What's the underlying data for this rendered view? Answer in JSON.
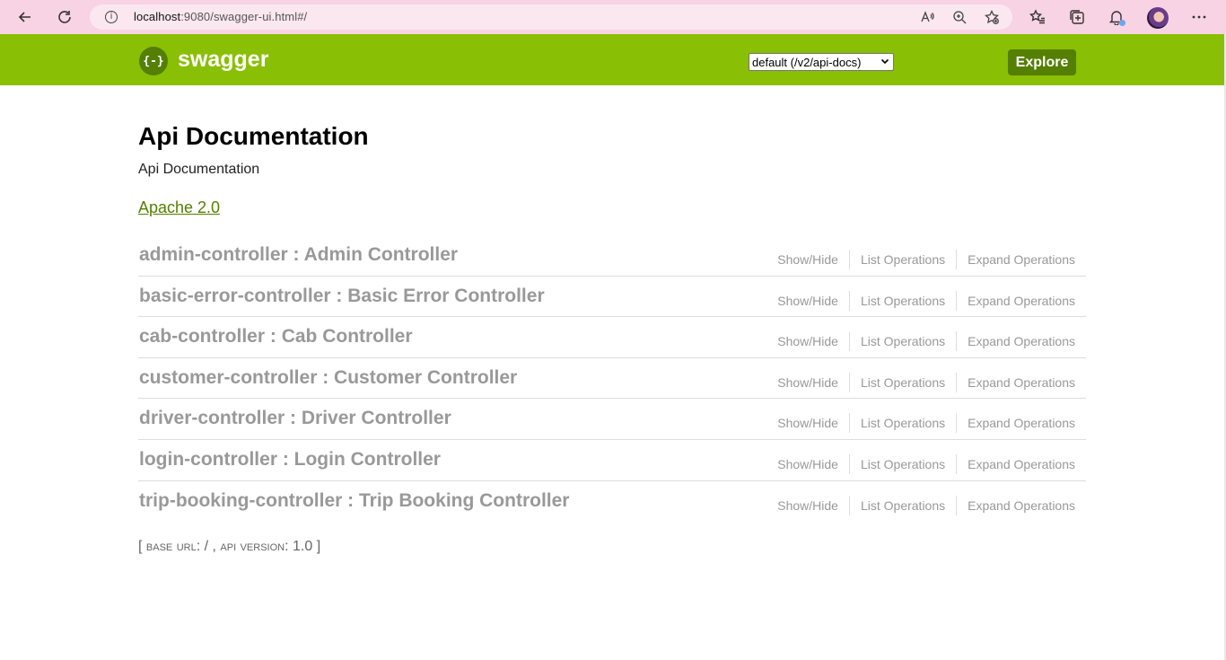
{
  "browser": {
    "url_host": "localhost",
    "url_rest": ":9080/swagger-ui.html#/",
    "icons": [
      "back-icon",
      "refresh-icon",
      "info-icon",
      "read-aloud-icon",
      "zoom-icon",
      "add-favorite-icon",
      "favorites-icon",
      "collections-icon",
      "notifications-icon",
      "profile-avatar",
      "more-icon"
    ]
  },
  "header": {
    "logo_glyph": "{-}",
    "logo_text": "swagger",
    "spec_select_value": "default (/v2/api-docs)",
    "explore_label": "Explore",
    "color": "#89bf04",
    "button_color": "#547f00"
  },
  "info": {
    "title": "Api Documentation",
    "description": "Api Documentation",
    "license": "Apache 2.0"
  },
  "resources": [
    {
      "name": "admin-controller : Admin Controller"
    },
    {
      "name": "basic-error-controller : Basic Error Controller"
    },
    {
      "name": "cab-controller : Cab Controller"
    },
    {
      "name": "customer-controller : Customer Controller"
    },
    {
      "name": "driver-controller : Driver Controller"
    },
    {
      "name": "login-controller : Login Controller"
    },
    {
      "name": "trip-booking-controller : Trip Booking Controller"
    }
  ],
  "resource_actions": {
    "show_hide": "Show/Hide",
    "list_operations": "List Operations",
    "expand_operations": "Expand Operations"
  },
  "footer": {
    "open_bracket": "[",
    "base_url_label": "base url",
    "base_url_value": "/",
    "api_version_label": "api version",
    "api_version_value": "1.0",
    "close_bracket": "]"
  }
}
